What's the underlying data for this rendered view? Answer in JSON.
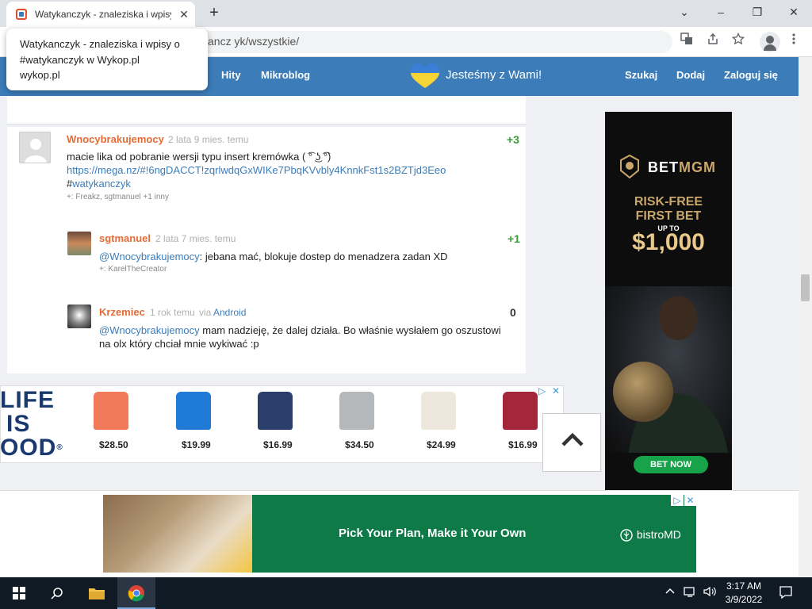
{
  "browser": {
    "tab_title": "Watykanczyk - znaleziska i wpisy",
    "tab_close": "✕",
    "new_tab": "+",
    "url": "ancz yk/wszystkie/",
    "window_controls": {
      "minimize": "–",
      "restore": "❐",
      "close": "✕",
      "tablist": "⌄"
    }
  },
  "tooltip": {
    "title": "Watykanczyk - znaleziska i wpisy o #watykanczyk w Wykop.pl",
    "domain": "wykop.pl"
  },
  "header": {
    "nav": [
      "Hity",
      "Mikroblog"
    ],
    "support_text": "Jesteśmy z Wami!",
    "right_nav": [
      "Szukaj",
      "Dodaj",
      "Zaloguj się"
    ],
    "heart_colors": {
      "top": "#3a7fd5",
      "bottom": "#f7d436"
    }
  },
  "posts": {
    "main": {
      "author": "Wnocybrakujemocy",
      "meta": "2 lata 9 mies. temu",
      "votes": "+3",
      "text": "macie lika od pobranie wersji typu insert kremówka ( ͡° ͜ʖ ͡°)",
      "link": "https://mega.nz/#!6ngDACCT!zqrlwdqGxWIKe7PbqKVvbly4KnnkFst1s2BZTjd3Eeo",
      "hashtag_prefix": "#",
      "hashtag": "watykanczyk",
      "plus": "+: Freakz, sgtmanuel +1 inny"
    },
    "reply1": {
      "author": "sgtmanuel",
      "meta": "2 lata 7 mies. temu",
      "votes": "+1",
      "mention": "@Wnocybrakujemocy",
      "text": ": jebana mać, blokuje dostep do menadzera zadan XD",
      "plus": "+: KarelTheCreator"
    },
    "reply2": {
      "author": "Krzemiec",
      "meta": "1 rok temu",
      "via": "via",
      "via_app": "Android",
      "votes": "0",
      "mention": "@Wnocybrakujemocy",
      "text_line1": " mam nadzieję, że dalej działa. Bo właśnie wysłałem go oszustowi",
      "text_line2": "na olx który chciał mnie wykiwać :p"
    }
  },
  "ad_shop": {
    "brand_lines": [
      "LIFE",
      "IS",
      "OOD"
    ],
    "registered": "®",
    "products": [
      {
        "price": "$28.50",
        "color": "#f07a5a"
      },
      {
        "price": "$19.99",
        "color": "#1f7bd6"
      },
      {
        "price": "$16.99",
        "color": "#2c3e6b"
      },
      {
        "price": "$34.50",
        "color": "#b5b8bb"
      },
      {
        "price": "$24.99",
        "color": "#eee8dc"
      },
      {
        "price": "$16.99",
        "color": "#a3263a"
      }
    ],
    "adchoices": "▷",
    "close": "✕"
  },
  "scroll_top_glyph": "⌃",
  "skyscraper": {
    "brand_a": "BET",
    "brand_b": "MGM",
    "offer_lines": [
      "RISK-FREE",
      "FIRST BET"
    ],
    "up_to": "UP TO",
    "amount": "$1,000",
    "cta": "BET NOW"
  },
  "bottom_banner": {
    "headline": "Pick Your Plan, Make it Your Own",
    "logo": "bistroMD",
    "adchoices": "▷",
    "close": "✕"
  },
  "taskbar": {
    "time": "3:17 AM",
    "date": "3/9/2022"
  }
}
